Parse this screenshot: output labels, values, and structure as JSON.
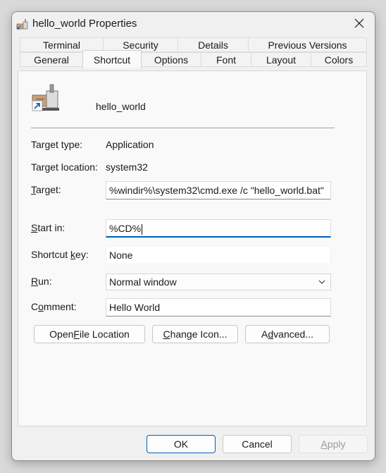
{
  "window": {
    "title": "hello_world Properties"
  },
  "tabs": {
    "row_back": [
      "Terminal",
      "Security",
      "Details",
      "Previous Versions"
    ],
    "row_front": [
      "General",
      "Shortcut",
      "Options",
      "Font",
      "Layout",
      "Colors"
    ],
    "active": "Shortcut"
  },
  "shortcut": {
    "name": "hello_world",
    "target_type_label": "Target type:",
    "target_type_value": "Application",
    "target_location_label": "Target location:",
    "target_location_value": "system32",
    "target_label_pre": "",
    "target_label_key": "T",
    "target_label_post": "arget:",
    "target_value": "%windir%\\system32\\cmd.exe /c \"hello_world.bat\"",
    "start_in_label_key": "S",
    "start_in_label_post": "tart in:",
    "start_in_value": "%CD%",
    "shortcut_key_label_pre": "Shortcut ",
    "shortcut_key_label_key": "k",
    "shortcut_key_label_post": "ey:",
    "shortcut_key_value": "None",
    "run_label_key": "R",
    "run_label_post": "un:",
    "run_value": "Normal window",
    "comment_label_pre": "C",
    "comment_label_key": "o",
    "comment_label_post": "mment:",
    "comment_value": "Hello World"
  },
  "buttons": {
    "open_file_location_pre": "Open ",
    "open_file_location_key": "F",
    "open_file_location_post": "ile Location",
    "change_icon_key": "C",
    "change_icon_post": "hange Icon...",
    "advanced_pre": "A",
    "advanced_key": "d",
    "advanced_post": "vanced...",
    "ok": "OK",
    "cancel": "Cancel",
    "apply_key": "A",
    "apply_post": "pply"
  },
  "colors": {
    "accent": "#005fb8"
  }
}
